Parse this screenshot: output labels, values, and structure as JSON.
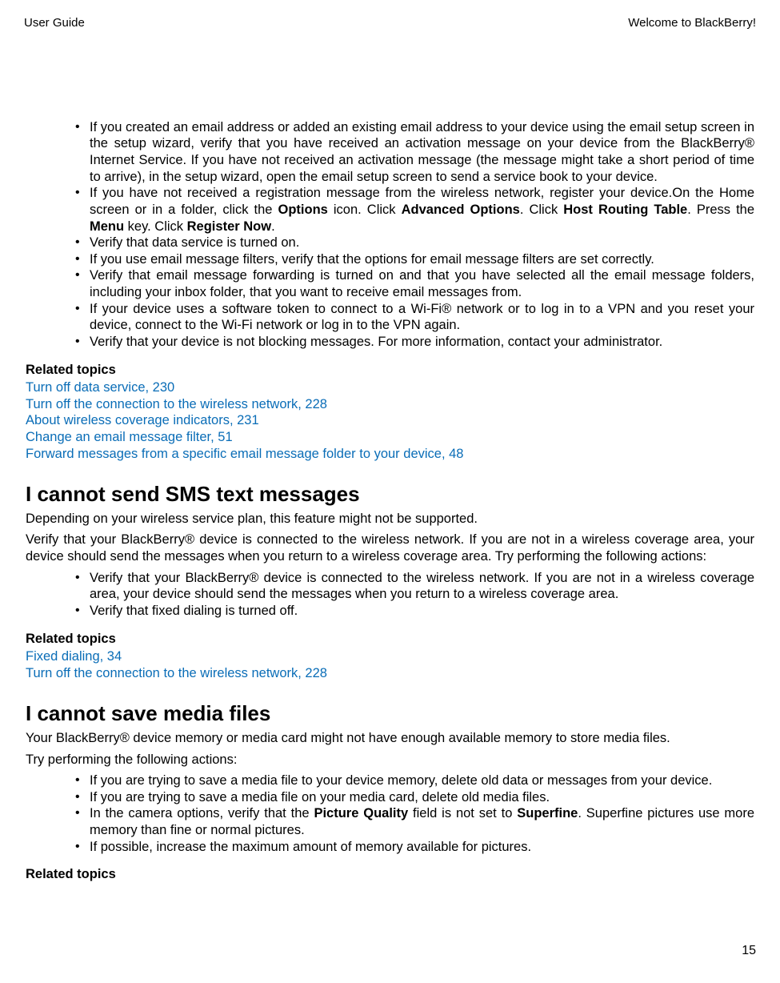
{
  "header": {
    "left": "User Guide",
    "right": "Welcome to BlackBerry!"
  },
  "section1": {
    "bullets": [
      "If you created an email address or added an existing email address to your device using the email setup screen in the setup wizard, verify that you have received an activation message on your device from the BlackBerry® Internet Service. If you have not received an activation message (the message might take a short period of time to arrive), in the setup wizard, open the email setup screen to send a service book to your device.",
      "",
      "Verify that data service is turned on.",
      "If you use email message filters, verify that the options for email message filters are set correctly.",
      "Verify that email message forwarding is turned on and that you have selected all the email message folders, including your inbox folder, that you want to receive email messages from.",
      "If your device uses a software token to connect to a Wi-Fi® network or to log in to a VPN and you reset your device, connect to the Wi-Fi network or log in to the VPN again.",
      "Verify that your device is not blocking messages. For more information, contact your administrator."
    ],
    "bullet2": {
      "pre": "If you have not received a registration message from the wireless network, register your device.On the Home screen or in a folder, click the ",
      "b1": "Options",
      "t1": " icon. Click ",
      "b2": "Advanced Options",
      "t2": ". Click ",
      "b3": "Host Routing Table",
      "t3": ". Press the ",
      "b4": "Menu",
      "t4": " key. Click ",
      "b5": "Register Now",
      "t5": "."
    },
    "related_heading": "Related topics",
    "links": [
      "Turn off data service, 230",
      "Turn off the connection to the wireless network, 228",
      "About wireless coverage indicators, 231",
      "Change an email message filter, 51",
      "Forward messages from a specific email message folder to your device, 48"
    ]
  },
  "section2": {
    "heading": "I cannot send SMS text messages",
    "para1": "Depending on your wireless service plan, this feature might not be supported.",
    "para2": "Verify that your BlackBerry® device is connected to the wireless network. If you are not in a wireless coverage area, your device should send the messages when you return to a wireless coverage area. Try performing the following actions:",
    "bullets": [
      "Verify that your BlackBerry® device is connected to the wireless network. If you are not in a wireless coverage area, your device should send the messages when you return to a wireless coverage area.",
      "Verify that fixed dialing is turned off."
    ],
    "related_heading": "Related topics",
    "links": [
      "Fixed dialing, 34",
      "Turn off the connection to the wireless network, 228"
    ]
  },
  "section3": {
    "heading": "I cannot save media files",
    "para1": "Your BlackBerry® device memory or media card might not have enough available memory to store media files.",
    "para2": "Try performing the following actions:",
    "bullets": [
      "If you are trying to save a media file to your device memory, delete old data or messages from your device.",
      "If you are trying to save a media file on your media card, delete old media files.",
      "",
      "If possible, increase the maximum amount of memory available for pictures."
    ],
    "bullet3": {
      "pre": "In the camera options, verify that the ",
      "b1": "Picture Quality",
      "t1": " field is not set to ",
      "b2": "Superfine",
      "t2": ". Superfine pictures use more memory than fine or normal pictures."
    },
    "related_heading": "Related topics"
  },
  "page_number": "15"
}
